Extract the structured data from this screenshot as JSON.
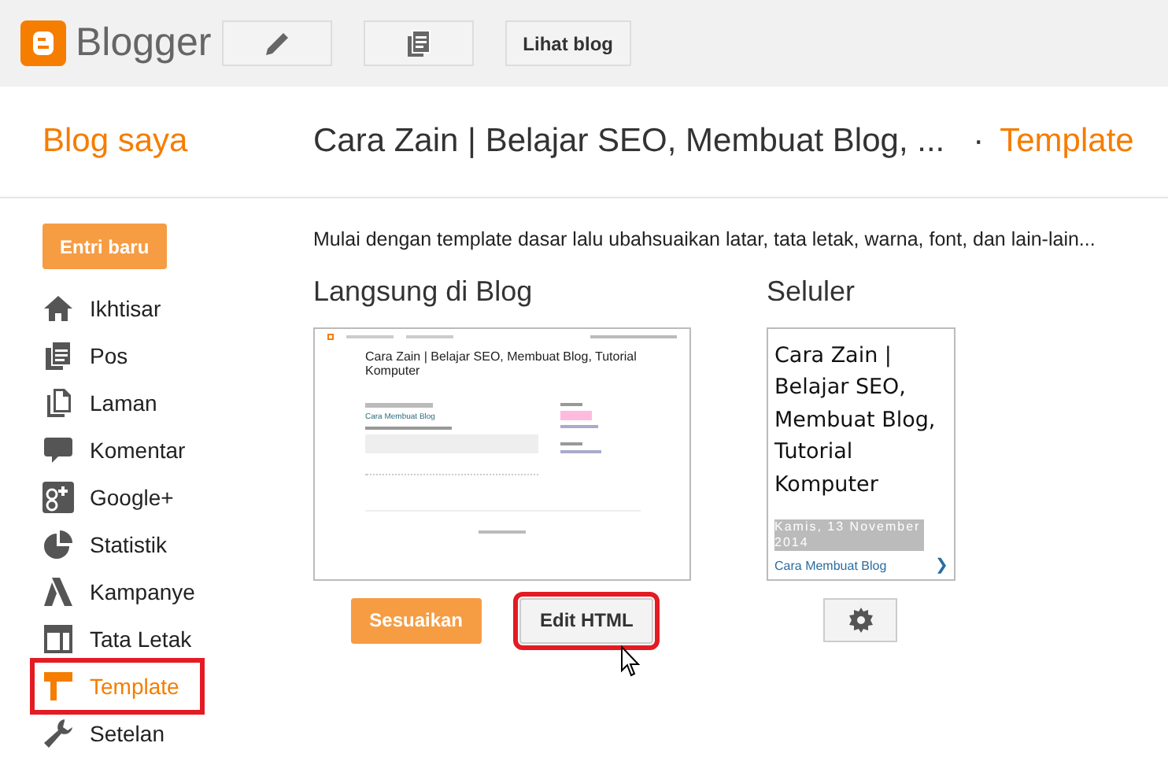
{
  "header": {
    "logo_text": "Blogger",
    "view_blog_button": "Lihat blog"
  },
  "title_bar": {
    "section": "Blog saya",
    "blog_title": "Cara Zain | Belajar SEO, Membuat Blog, ...",
    "separator": "·",
    "page": "Template"
  },
  "sidebar": {
    "new_post_button": "Entri baru",
    "items": [
      {
        "label": "Ikhtisar",
        "selected": false,
        "highlighted": false
      },
      {
        "label": "Pos",
        "selected": false,
        "highlighted": false
      },
      {
        "label": "Laman",
        "selected": false,
        "highlighted": false
      },
      {
        "label": "Komentar",
        "selected": false,
        "highlighted": false
      },
      {
        "label": "Google+",
        "selected": false,
        "highlighted": false
      },
      {
        "label": "Statistik",
        "selected": false,
        "highlighted": false
      },
      {
        "label": "Kampanye",
        "selected": false,
        "highlighted": false
      },
      {
        "label": "Tata Letak",
        "selected": false,
        "highlighted": false
      },
      {
        "label": "Template",
        "selected": true,
        "highlighted": true
      },
      {
        "label": "Setelan",
        "selected": false,
        "highlighted": false
      }
    ]
  },
  "content": {
    "intro": "Mulai dengan template dasar lalu ubahsuaikan latar, tata letak, warna, font, dan lain-lain...",
    "desktop": {
      "heading": "Langsung di Blog",
      "preview_title": "Cara Zain | Belajar SEO, Membuat Blog, Tutorial Komputer",
      "preview_post": "Cara Membuat Blog",
      "buttons": [
        {
          "label": "Sesuaikan",
          "kind": "primary",
          "highlighted": false
        },
        {
          "label": "Edit HTML",
          "kind": "secondary",
          "highlighted": true
        }
      ]
    },
    "mobile": {
      "heading": "Seluler",
      "preview_title": "Cara Zain | Belajar SEO, Membuat Blog, Tutorial Komputer",
      "preview_date": "Kamis, 13 November 2014",
      "preview_post": "Cara Membuat Blog",
      "preview_next": "❯"
    }
  }
}
